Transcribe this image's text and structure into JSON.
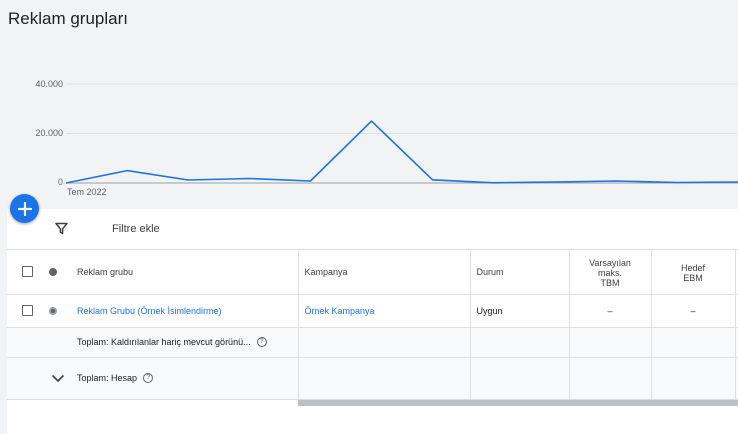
{
  "page": {
    "title": "Reklam grupları"
  },
  "chart_data": {
    "type": "line",
    "title": "",
    "xlabel": "",
    "ylabel": "",
    "y_ticks": [
      "40.000",
      "20.000",
      "0"
    ],
    "x_tick_labels": [
      "Tem 2022"
    ],
    "ylim": [
      0,
      40000
    ],
    "grid": true,
    "series": [
      {
        "color": "#1a73e8",
        "values": [
          0,
          5000,
          1200,
          1800,
          800,
          25000,
          1300,
          100,
          400,
          800,
          200,
          400
        ]
      }
    ]
  },
  "fab": {
    "icon": "add-icon"
  },
  "filter": {
    "label": "Filtre ekle",
    "icon": "filter-icon"
  },
  "table": {
    "headers": {
      "group": "Reklam grubu",
      "campaign": "Kampanya",
      "status": "Durum",
      "bid_l1": "Varsayılan",
      "bid_l2": "maks.",
      "bid_l3": "TBM",
      "ebm_l1": "Hedef",
      "ebm_l2": "EBM"
    },
    "rows": [
      {
        "group": "Reklam Grubu (Örnek İsimlendirme)",
        "campaign": "Örnek Kampanya",
        "status": "Uygun",
        "bid": "–",
        "ebm": "–"
      }
    ],
    "total_removed": "Toplam: Kaldırılanlar hariç mevcut görünü...",
    "total_account": "Toplam: Hesap",
    "help_glyph": "?"
  },
  "colors": {
    "accent": "#1a73e8",
    "line": "#1a73e8"
  }
}
